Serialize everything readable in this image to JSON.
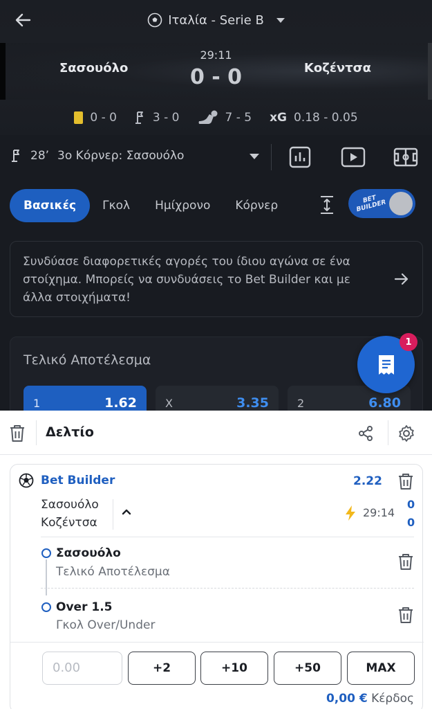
{
  "header": {
    "league": "Ιταλία - Serie B",
    "home_team": "Σασουόλο",
    "away_team": "Κοζέντσα",
    "clock": "29:11",
    "score": "0 - 0"
  },
  "stats": {
    "cards": "0 - 0",
    "corners": "3 - 0",
    "shots": "7 - 5",
    "xg_label": "xG",
    "xg_value": "0.18 - 0.05"
  },
  "event": {
    "minute": "28’",
    "text": "3ο Κόρνερ: Σασουόλο"
  },
  "tabs": [
    "Βασικές",
    "Γκολ",
    "Ημίχρονο",
    "Κόρνερ"
  ],
  "bet_builder_toggle": {
    "line1": "BET",
    "line2": "BUILDER"
  },
  "info_text": "Συνδύασε διαφορετικές αγορές του ίδιου αγώνα σε ένα στοίχημα. Μπορείς να συνδυάσεις το Bet Builder και με άλλα στοιχήματα!",
  "market": {
    "title": "Τελικό Αποτέλεσμα",
    "odds": [
      {
        "label": "1",
        "value": "1.62"
      },
      {
        "label": "X",
        "value": "3.35"
      },
      {
        "label": "2",
        "value": "6.80"
      }
    ]
  },
  "betslip_badge": "1",
  "slip": {
    "title": "Δελτίο",
    "bet_builder_label": "Bet Builder",
    "total_odds": "2.22",
    "home_team": "Σασουόλο",
    "away_team": "Κοζέντσα",
    "live_time": "29:14",
    "home_score": "0",
    "away_score": "0",
    "legs": [
      {
        "pick": "Σασουόλο",
        "market": "Τελικό Αποτέλεσμα"
      },
      {
        "pick": "Over 1.5",
        "market": "Γκολ Over/Under"
      }
    ],
    "stake_placeholder": "0.00",
    "quick_stakes": [
      "+2",
      "+10",
      "+50",
      "MAX"
    ],
    "profit_value": "0,00 €",
    "profit_label": "Κέρδος"
  },
  "colors": {
    "accent": "#1f5fc0",
    "badge": "#d81d5d",
    "yellow_card": "#e4be2d",
    "bolt": "#f2b81c"
  }
}
